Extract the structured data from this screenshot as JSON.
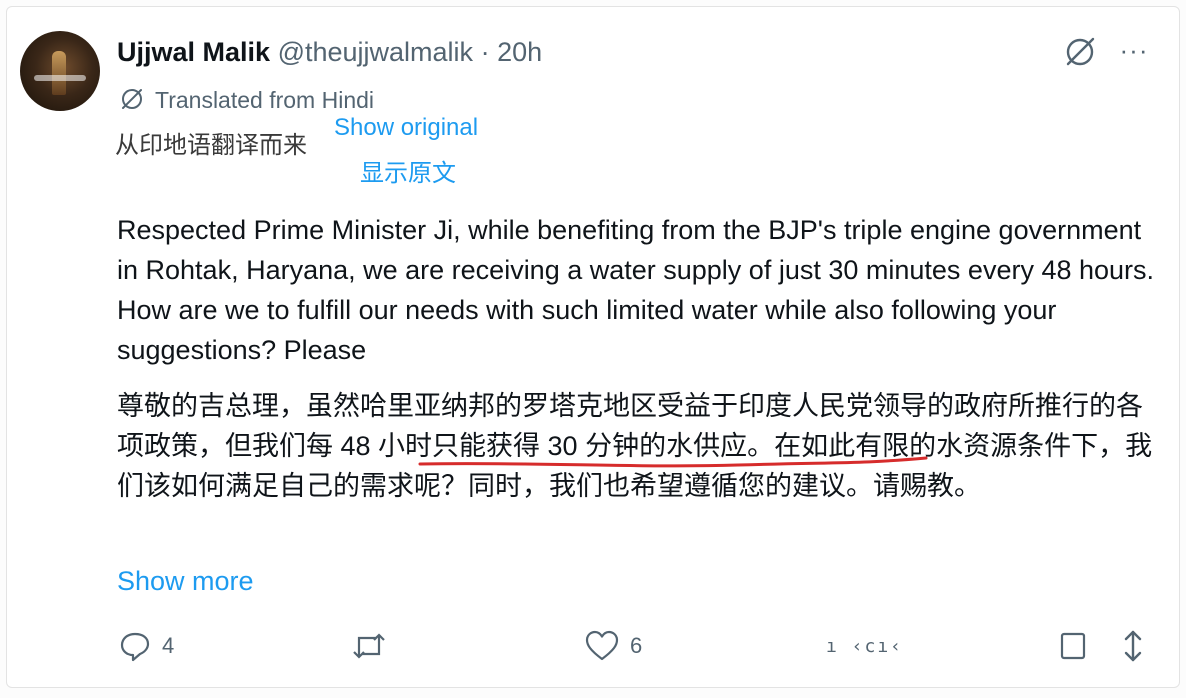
{
  "author": {
    "name": "Ujjwal Malik",
    "handle": "@theujjwalmalik",
    "separator": "·",
    "time": "20h"
  },
  "header_icons": [
    "grok-icon",
    "more-icon"
  ],
  "more_label": "···",
  "translation": {
    "label": "Translated from Hindi",
    "annotation_zh": "从印地语翻译而来",
    "show_original": "Show original",
    "annotation_zh_blue": "显示原文"
  },
  "body": {
    "english": "Respected Prime Minister Ji, while benefiting from the BJP's triple engine government in Rohtak, Haryana, we are receiving a water supply of just 30 minutes every 48 hours. How are we to fulfill our needs with such limited water while also following your suggestions? Please",
    "chinese": "尊敬的吉总理，虽然哈里亚纳邦的罗塔克地区受益于印度人民党领导的政府所推行的各项政策，但我们每 48 小时只能获得 30 分钟的水供应。在如此有限的水资源条件下，我们该如何满足自己的需求呢？同时，我们也希望遵循您的建议。请赐教。"
  },
  "show_more": "Show more",
  "actions": {
    "reply_count": "4",
    "retweet_count": "",
    "like_count": "6",
    "views_text": "ı ‹cı‹",
    "icons": [
      "reply-icon",
      "retweet-icon",
      "like-icon",
      "views-icon",
      "bookmark-icon",
      "share-icon"
    ]
  },
  "colors": {
    "link": "#1d9bf0",
    "meta": "#536471",
    "underline": "#d62c2c"
  }
}
